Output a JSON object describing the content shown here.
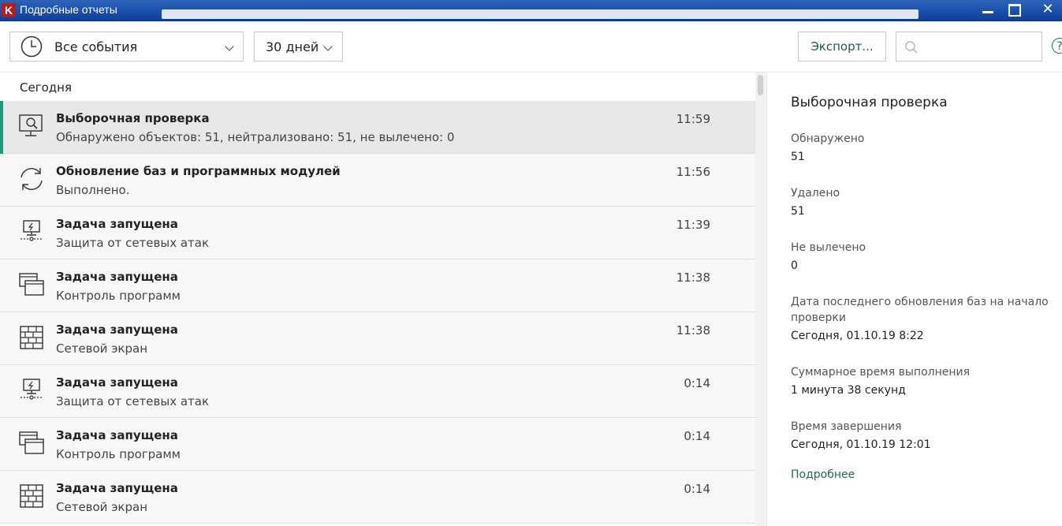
{
  "window": {
    "title": "Подробные отчеты",
    "logo_letter": "K",
    "buttons": {
      "minimize": "minimize",
      "maximize": "maximize",
      "close": "✕"
    }
  },
  "toolbar": {
    "events_filter": "Все события",
    "period_filter": "30 дней",
    "export_label": "Экспорт...",
    "search_value": "",
    "help": "?"
  },
  "list": {
    "group": "Сегодня",
    "events": [
      {
        "title": "Выборочная проверка",
        "subtitle": "Обнаружено объектов: 51, нейтрализовано: 51, не вылечено: 0",
        "time": "11:59",
        "icon": "custom-scan-icon",
        "selected": true
      },
      {
        "title": "Обновление баз и программных модулей",
        "subtitle": "Выполнено.",
        "time": "11:56",
        "icon": "update-icon",
        "selected": false
      },
      {
        "title": "Задача запущена",
        "subtitle": "Защита от сетевых атак",
        "time": "11:39",
        "icon": "network-attack-icon",
        "selected": false
      },
      {
        "title": "Задача запущена",
        "subtitle": "Контроль программ",
        "time": "11:38",
        "icon": "app-control-icon",
        "selected": false
      },
      {
        "title": "Задача запущена",
        "subtitle": "Сетевой экран",
        "time": "11:38",
        "icon": "firewall-icon",
        "selected": false
      },
      {
        "title": "Задача запущена",
        "subtitle": "Защита от сетевых атак",
        "time": "0:14",
        "icon": "network-attack-icon",
        "selected": false
      },
      {
        "title": "Задача запущена",
        "subtitle": "Контроль программ",
        "time": "0:14",
        "icon": "app-control-icon",
        "selected": false
      },
      {
        "title": "Задача запущена",
        "subtitle": "Сетевой экран",
        "time": "0:14",
        "icon": "firewall-icon",
        "selected": false
      }
    ]
  },
  "details": {
    "title": "Выборочная проверка",
    "fields": [
      {
        "label": "Обнаружено",
        "value": "51"
      },
      {
        "label": "Удалено",
        "value": "51"
      },
      {
        "label": "Не вылечено",
        "value": "0"
      },
      {
        "label": "Дата последнего обновления баз на начало проверки",
        "value": "Сегодня, 01.10.19 8:22"
      },
      {
        "label": "Суммарное время выполнения",
        "value": "1 минута 38 секунд"
      },
      {
        "label": "Время завершения",
        "value": "Сегодня, 01.10.19 12:01"
      }
    ],
    "more_link": "Подробнее"
  },
  "colors": {
    "accent": "#1a9a78",
    "link": "#1a6e52",
    "titlebar": "#1f55b0",
    "selected_row": "#e8e8e8",
    "row": "#f7f7f7"
  }
}
